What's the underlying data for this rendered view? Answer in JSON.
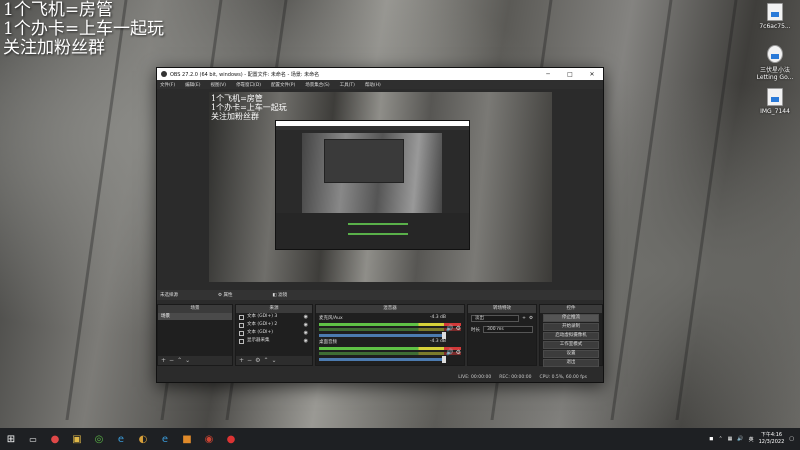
{
  "overlay": {
    "line1": "1个飞机=房管",
    "line2": "1个办卡=上车一起玩",
    "line3": "关注加粉丝群"
  },
  "desktop_icons": [
    {
      "label": "7c6ac75..."
    },
    {
      "label": "三伏星小法 Letting Go..."
    },
    {
      "label": "IMG_7144"
    }
  ],
  "obs": {
    "title": "OBS 27.2.0 (64 bit, windows) - 配置文件: 未命名 - 场景: 未命名",
    "menu": [
      "文件(F)",
      "编辑(E)",
      "视图(V)",
      "停靠窗口(D)",
      "配置文件(P)",
      "场景集合(S)",
      "工具(T)",
      "帮助(H)"
    ],
    "preview_text": {
      "line1": "1个飞机=房管",
      "line2": "1个办卡=上车一起玩",
      "line3": "关注加粉丝群"
    },
    "selected_source": "未选择源",
    "props_label": "属性",
    "filters_label": "滤镜",
    "docks": {
      "scenes": {
        "title": "场景",
        "items": [
          "场景"
        ]
      },
      "sources": {
        "title": "来源",
        "items": [
          {
            "label": "文本 (GDI+) 3"
          },
          {
            "label": "文本 (GDI+) 2"
          },
          {
            "label": "文本 (GDI+)"
          },
          {
            "label": "显示器采集"
          }
        ]
      },
      "mixer": {
        "title": "混音器",
        "channels": [
          {
            "name": "麦克风/Aux",
            "db": "-4.3 dB"
          },
          {
            "name": "桌面音频",
            "db": "-4.3 dB"
          }
        ]
      },
      "transitions": {
        "title": "转场特效",
        "type": "淡出",
        "duration_label": "时长",
        "duration_value": "300 ms"
      },
      "controls": {
        "title": "控件",
        "buttons": [
          "停止推流",
          "开始录制",
          "启动虚拟摄像机",
          "工作室模式",
          "设置",
          "退出"
        ]
      }
    },
    "status": {
      "live": "LIVE: 00:00:00",
      "rec": "REC: 00:00:00",
      "cpu": "CPU: 0.5%, 60.00 fps"
    }
  },
  "taskbar": {
    "time": "下午4:16",
    "date": "12/3/2022",
    "ime": "英"
  }
}
